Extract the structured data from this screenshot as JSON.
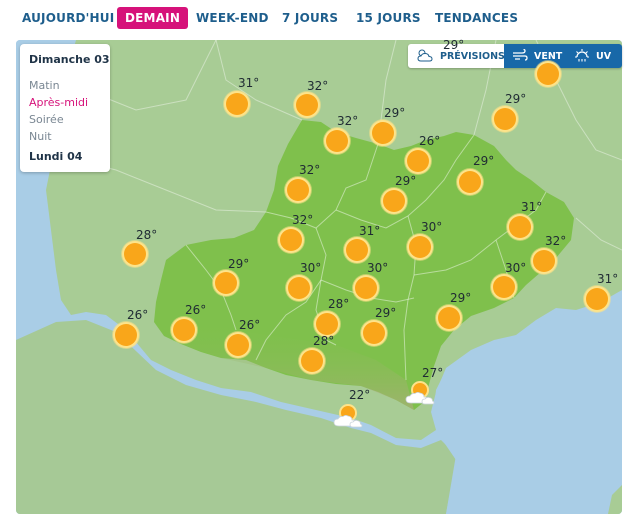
{
  "tabs": [
    {
      "label": "AUJOURD'HUI",
      "active": false
    },
    {
      "label": "DEMAIN",
      "active": true
    },
    {
      "label": "WEEK-END",
      "active": false
    },
    {
      "label": "7 JOURS",
      "active": false
    },
    {
      "label": "15 JOURS",
      "active": false
    },
    {
      "label": "TENDANCES",
      "active": false
    }
  ],
  "day_panel": {
    "day1": "Dimanche 03",
    "periods": [
      {
        "label": "Matin",
        "active": false
      },
      {
        "label": "Après-midi",
        "active": true
      },
      {
        "label": "Soirée",
        "active": false
      },
      {
        "label": "Nuit",
        "active": false
      }
    ],
    "day2": "Lundi 04"
  },
  "layers": [
    {
      "label": "PRÉVISIONS",
      "icon": "cloud-sun-icon",
      "active": true
    },
    {
      "label": "VENT",
      "icon": "wind-icon",
      "active": false
    },
    {
      "label": "UV",
      "icon": "uv-sun-icon",
      "active": false
    }
  ],
  "colors": {
    "accent": "#d6127a",
    "tab_text": "#1e5e8c",
    "sea": "#a9cde6",
    "land": "#9cc48a",
    "region": "#7fc04c",
    "sun": "#f9a61a"
  },
  "forecast": [
    {
      "temp": "29°",
      "icon": "sun"
    },
    {
      "temp": "31°",
      "icon": "sun"
    },
    {
      "temp": "32°",
      "icon": "sun"
    },
    {
      "temp": "32°",
      "icon": "sun"
    },
    {
      "temp": "29°",
      "icon": "sun"
    },
    {
      "temp": "29°",
      "icon": "sun"
    },
    {
      "temp": "26°",
      "icon": "sun"
    },
    {
      "temp": "32°",
      "icon": "sun"
    },
    {
      "temp": "29°",
      "icon": "sun"
    },
    {
      "temp": "29°",
      "icon": "sun"
    },
    {
      "temp": "31°",
      "icon": "sun"
    },
    {
      "temp": "32°",
      "icon": "sun"
    },
    {
      "temp": "28°",
      "icon": "sun"
    },
    {
      "temp": "31°",
      "icon": "sun"
    },
    {
      "temp": "30°",
      "icon": "sun"
    },
    {
      "temp": "32°",
      "icon": "sun"
    },
    {
      "temp": "29°",
      "icon": "sun"
    },
    {
      "temp": "30°",
      "icon": "sun"
    },
    {
      "temp": "30°",
      "icon": "sun"
    },
    {
      "temp": "30°",
      "icon": "sun"
    },
    {
      "temp": "31°",
      "icon": "sun"
    },
    {
      "temp": "26°",
      "icon": "sun"
    },
    {
      "temp": "26°",
      "icon": "sun"
    },
    {
      "temp": "26°",
      "icon": "sun"
    },
    {
      "temp": "28°",
      "icon": "sun"
    },
    {
      "temp": "29°",
      "icon": "sun"
    },
    {
      "temp": "29°",
      "icon": "sun"
    },
    {
      "temp": "28°",
      "icon": "sun"
    },
    {
      "temp": "27°",
      "icon": "cloud-sun"
    },
    {
      "temp": "22°",
      "icon": "cloud-sun"
    }
  ]
}
